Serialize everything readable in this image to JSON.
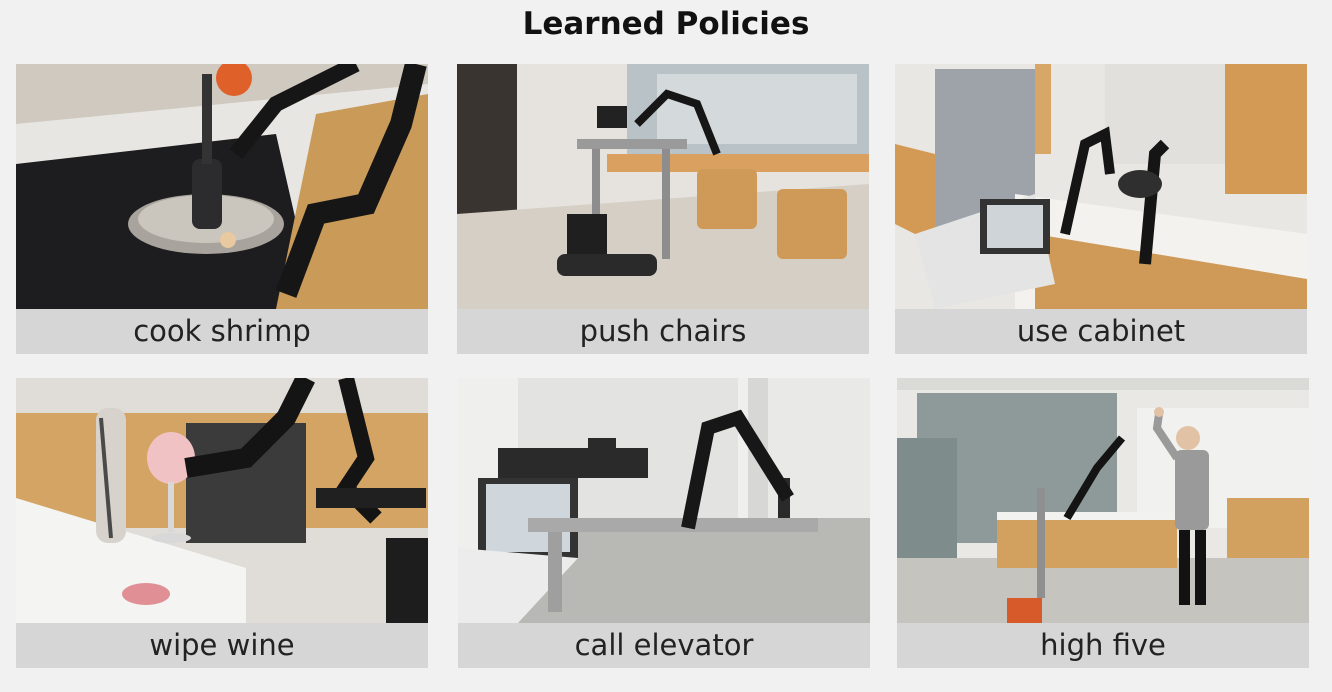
{
  "page": {
    "title": "Learned Policies"
  },
  "tiles": [
    {
      "caption": "cook shrimp",
      "photo": "robot-cooking-shrimp-photo"
    },
    {
      "caption": "push chairs",
      "photo": "robot-pushing-chairs-photo"
    },
    {
      "caption": "use cabinet",
      "photo": "robot-using-cabinet-photo"
    },
    {
      "caption": "wipe wine",
      "photo": "robot-wiping-wine-photo"
    },
    {
      "caption": "call elevator",
      "photo": "robot-calling-elevator-photo"
    },
    {
      "caption": "high five",
      "photo": "robot-high-five-photo"
    }
  ]
}
